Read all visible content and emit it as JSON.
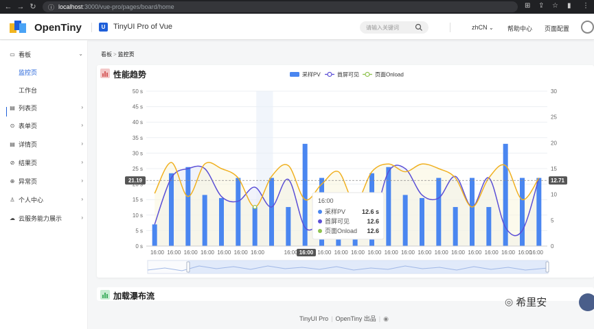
{
  "browser": {
    "url_host": "localhost",
    "url_path": ":3000/vue-pro/pages/board/home"
  },
  "header": {
    "brand": "OpenTiny",
    "subtitle": "TinyUI Pro of Vue",
    "search_placeholder": "请输入关键词",
    "lang": "zhCN",
    "help": "帮助中心",
    "page_config": "页面配置",
    "vue_mark": "U"
  },
  "sidebar": {
    "items": [
      {
        "label": "看板",
        "icon": "monitor-icon"
      },
      {
        "label": "列表页",
        "icon": "list-icon"
      },
      {
        "label": "表单页",
        "icon": "form-icon"
      },
      {
        "label": "详情页",
        "icon": "detail-icon"
      },
      {
        "label": "结果页",
        "icon": "check-circle-icon"
      },
      {
        "label": "异常页",
        "icon": "warning-icon"
      },
      {
        "label": "个人中心",
        "icon": "user-icon"
      },
      {
        "label": "云服务能力展示",
        "icon": "cloud-icon"
      }
    ],
    "sub_items": [
      "监控页",
      "工作台"
    ]
  },
  "breadcrumb": {
    "root": "看板",
    "current": "监控页"
  },
  "card1": {
    "title": "性能趋势"
  },
  "card2": {
    "title": "加载瀑布流"
  },
  "footer": {
    "left": "TinyUI Pro",
    "right": "OpenTiny 出品"
  },
  "watermark": "希里安",
  "colors": {
    "accent": "#1e5fd9",
    "bar": "#4a86f0",
    "line_blue": "#5b4fd6",
    "line_yellow": "#f0b020",
    "line_green": "#8fc34f"
  },
  "chart_data": {
    "type": "bar",
    "legend": [
      "采样PV",
      "首屏可见",
      "页面Onload"
    ],
    "categories": [
      "16:00",
      "16:00",
      "16:00",
      "16:00",
      "16:00",
      "16:00",
      "16:00",
      "16:00",
      "16:00",
      "16:00",
      "16:00",
      "16:00",
      "16:00",
      "16:00",
      "16:00",
      "16:00",
      "16:00",
      "16:00",
      "16:00",
      "16:00",
      "16:00",
      "16:00",
      "16:00",
      "16:00"
    ],
    "y_left_ticks": [
      "0 s",
      "5 s",
      "10 s",
      "15 s",
      "20 s",
      "25 s",
      "30 s",
      "35 s",
      "40 s",
      "45 s",
      "50 s"
    ],
    "y_right_ticks": [
      "0",
      "5",
      "10",
      "15",
      "20",
      "25",
      "30"
    ],
    "ylim_left": [
      0,
      50
    ],
    "ylim_right": [
      0,
      30
    ],
    "series": [
      {
        "name": "采样PV",
        "values": [
          7,
          23.5,
          25.5,
          16.5,
          15.5,
          22,
          12.6,
          22,
          12.6,
          33,
          22,
          5,
          7,
          23.5,
          25.5,
          16.5,
          15.5,
          22,
          12.6,
          22,
          12.6,
          33,
          22,
          22
        ]
      },
      {
        "name": "首屏可见",
        "values": [
          7,
          22,
          25,
          25,
          16,
          14.5,
          19,
          12.6,
          21.5,
          6,
          7,
          5,
          5,
          7,
          24,
          25,
          16.5,
          15.5,
          22.5,
          12.6,
          22,
          6,
          5,
          22
        ]
      },
      {
        "name": "页面Onload",
        "values": [
          17,
          27,
          16,
          26.5,
          25,
          22,
          12.6,
          22.5,
          26,
          15,
          20,
          24,
          14,
          24,
          26.5,
          24,
          26.5,
          25,
          22,
          12.6,
          22,
          26,
          15,
          22
        ]
      }
    ],
    "crosshair_left_label": "21.19",
    "crosshair_right_label": "12.71",
    "x_highlight_label": "16:00",
    "tooltip": {
      "title": "16:00",
      "rows": [
        {
          "name": "采样PV",
          "value": "12.6 s"
        },
        {
          "name": "首屏可见",
          "value": "12.6"
        },
        {
          "name": "页面Onload",
          "value": "12.6"
        }
      ]
    },
    "highlight_index": 6,
    "crosshair_value_left": 21.19
  }
}
